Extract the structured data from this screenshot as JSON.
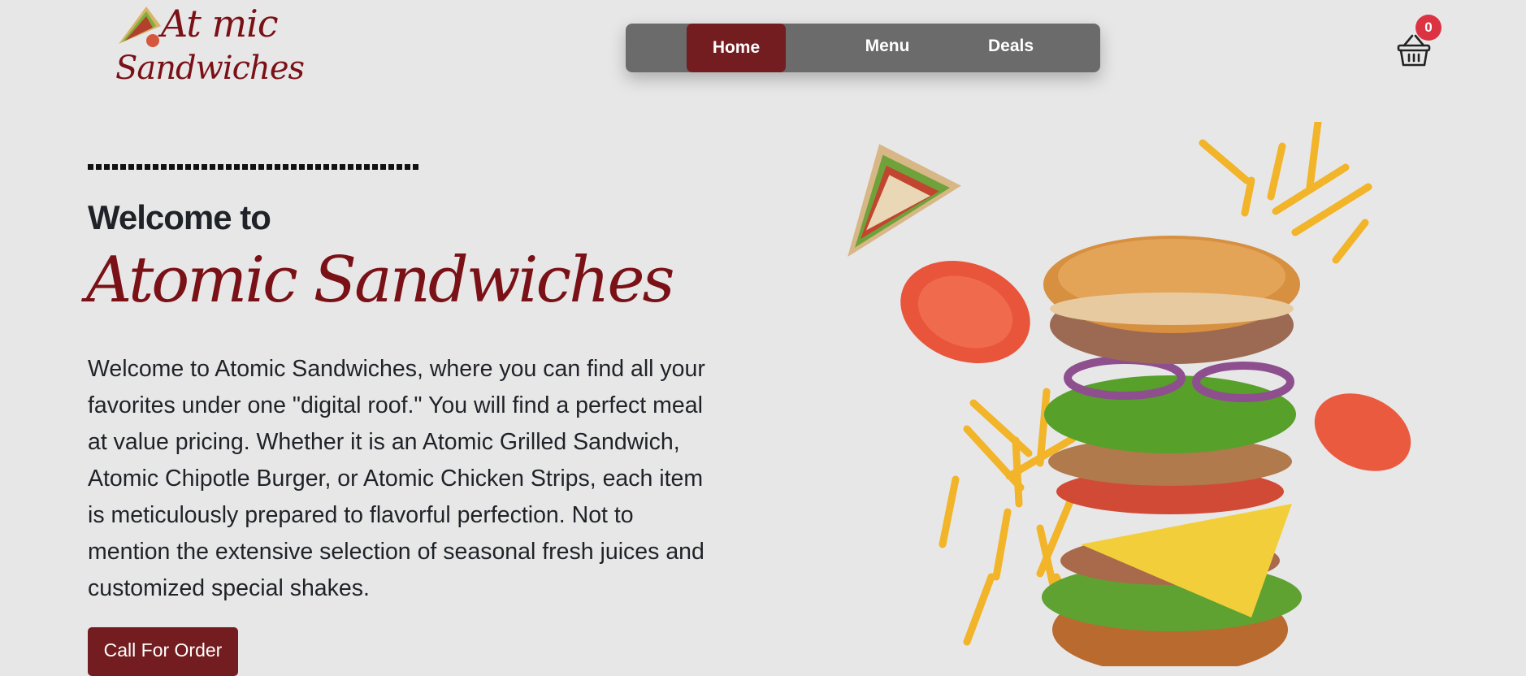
{
  "logo": {
    "line1": "At mic",
    "line2": "Sandwiches"
  },
  "nav": {
    "home": "Home",
    "menu": "Menu",
    "deals": "Deals"
  },
  "cart": {
    "count": "0"
  },
  "hero": {
    "welcome": "Welcome to",
    "brand": "Atomic Sandwiches",
    "description_lines": [
      "Welcome to Atomic Sandwiches, where you can find all your",
      "favorites under one \"digital roof.\" You will find a perfect meal",
      "at value pricing. Whether it is an Atomic Grilled Sandwich,",
      "Atomic Chipotle Burger, or Atomic Chicken Strips, each item",
      "is meticulously prepared to flavorful perfection. Not to",
      "mention the extensive selection of seasonal fresh juices and",
      "customized special shakes."
    ],
    "cta": "Call For Order"
  },
  "colors": {
    "brand": "#7a1116",
    "button": "#731d20",
    "nav_bg": "#6b6b6b",
    "badge": "#dc3343",
    "page_bg": "#e8e7e8"
  }
}
